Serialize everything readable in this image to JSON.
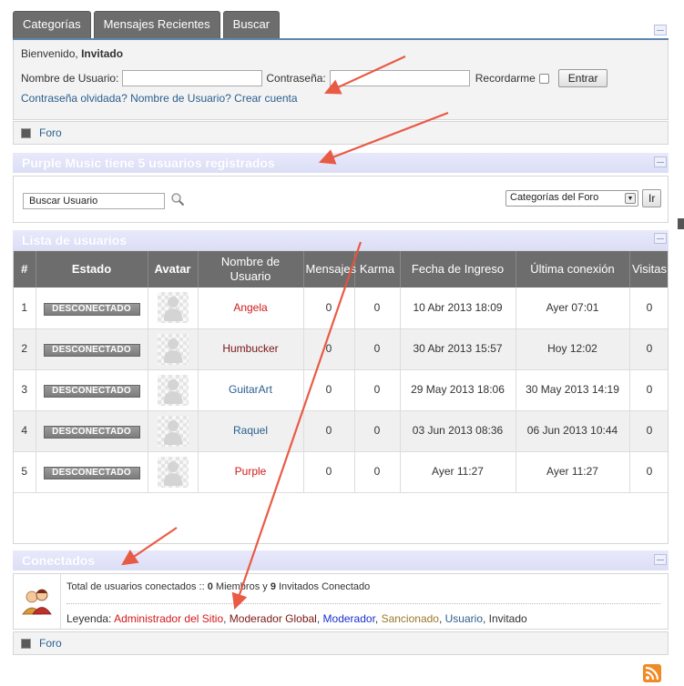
{
  "tabs": [
    {
      "label": "Categorías"
    },
    {
      "label": "Mensajes Recientes"
    },
    {
      "label": "Buscar"
    }
  ],
  "login": {
    "welcome_prefix": "Bienvenido,",
    "welcome_user": "Invitado",
    "username_label": "Nombre de Usuario:",
    "password_label": "Contraseña:",
    "remember_label": "Recordarme",
    "submit_label": "Entrar",
    "forgot_password": "Contraseña olvidada?",
    "forgot_username": "Nombre de Usuario?",
    "create_account": "Crear cuenta"
  },
  "forum_link": "Foro",
  "stats_title": "Purple Music tiene 5 usuarios registrados",
  "search": {
    "user_search_value": "Buscar Usuario",
    "category_select": "Categorías del Foro",
    "go_label": "Ir"
  },
  "userlist_title": "Lista de usuarios",
  "table": {
    "headers": [
      "#",
      "Estado",
      "Avatar",
      "Nombre de Usuario",
      "Mensajes",
      "Karma",
      "Fecha de Ingreso",
      "Última conexión",
      "Visitas"
    ],
    "rows": [
      {
        "num": "1",
        "status": "DESCONECTADO",
        "name": "Angela",
        "name_color": "#d01a1a",
        "posts": "0",
        "karma": "0",
        "joined": "10 Abr 2013 18:09",
        "last": "Ayer 07:01",
        "visits": "0"
      },
      {
        "num": "2",
        "status": "DESCONECTADO",
        "name": "Humbucker",
        "name_color": "#7a1616",
        "posts": "0",
        "karma": "0",
        "joined": "30 Abr 2013 15:57",
        "last": "Hoy 12:02",
        "visits": "0"
      },
      {
        "num": "3",
        "status": "DESCONECTADO",
        "name": "GuitarArt",
        "name_color": "#2a5f8e",
        "posts": "0",
        "karma": "0",
        "joined": "29 May 2013 18:06",
        "last": "30 May 2013 14:19",
        "visits": "0"
      },
      {
        "num": "4",
        "status": "DESCONECTADO",
        "name": "Raquel",
        "name_color": "#2a5f8e",
        "posts": "0",
        "karma": "0",
        "joined": "03 Jun 2013 08:36",
        "last": "06 Jun 2013 10:44",
        "visits": "0"
      },
      {
        "num": "5",
        "status": "DESCONECTADO",
        "name": "Purple",
        "name_color": "#d01a1a",
        "posts": "0",
        "karma": "0",
        "joined": "Ayer 11:27",
        "last": "Ayer 11:27",
        "visits": "0"
      }
    ]
  },
  "connected": {
    "title": "Conectados",
    "total_prefix": "Total de usuarios conectados ::",
    "members": "0",
    "members_label": "Miembros y",
    "guests": "9",
    "guests_label": "Invitados Conectado",
    "legend_label": "Leyenda:",
    "legend": [
      {
        "label": "Administrador del Sitio",
        "color": "#d01a1a"
      },
      {
        "label": "Moderador Global",
        "color": "#7a1616"
      },
      {
        "label": "Moderador",
        "color": "#1a2fd0"
      },
      {
        "label": "Sancionado",
        "color": "#9a7a2a"
      },
      {
        "label": "Usuario",
        "color": "#2a5f8e"
      },
      {
        "label": "Invitado",
        "color": "#333333"
      }
    ]
  },
  "colors": {
    "tab_bg": "#6d6d6d",
    "section_header": "#dcdef5",
    "link": "#2a5f8e",
    "annotation_arrow": "#e8533c"
  }
}
